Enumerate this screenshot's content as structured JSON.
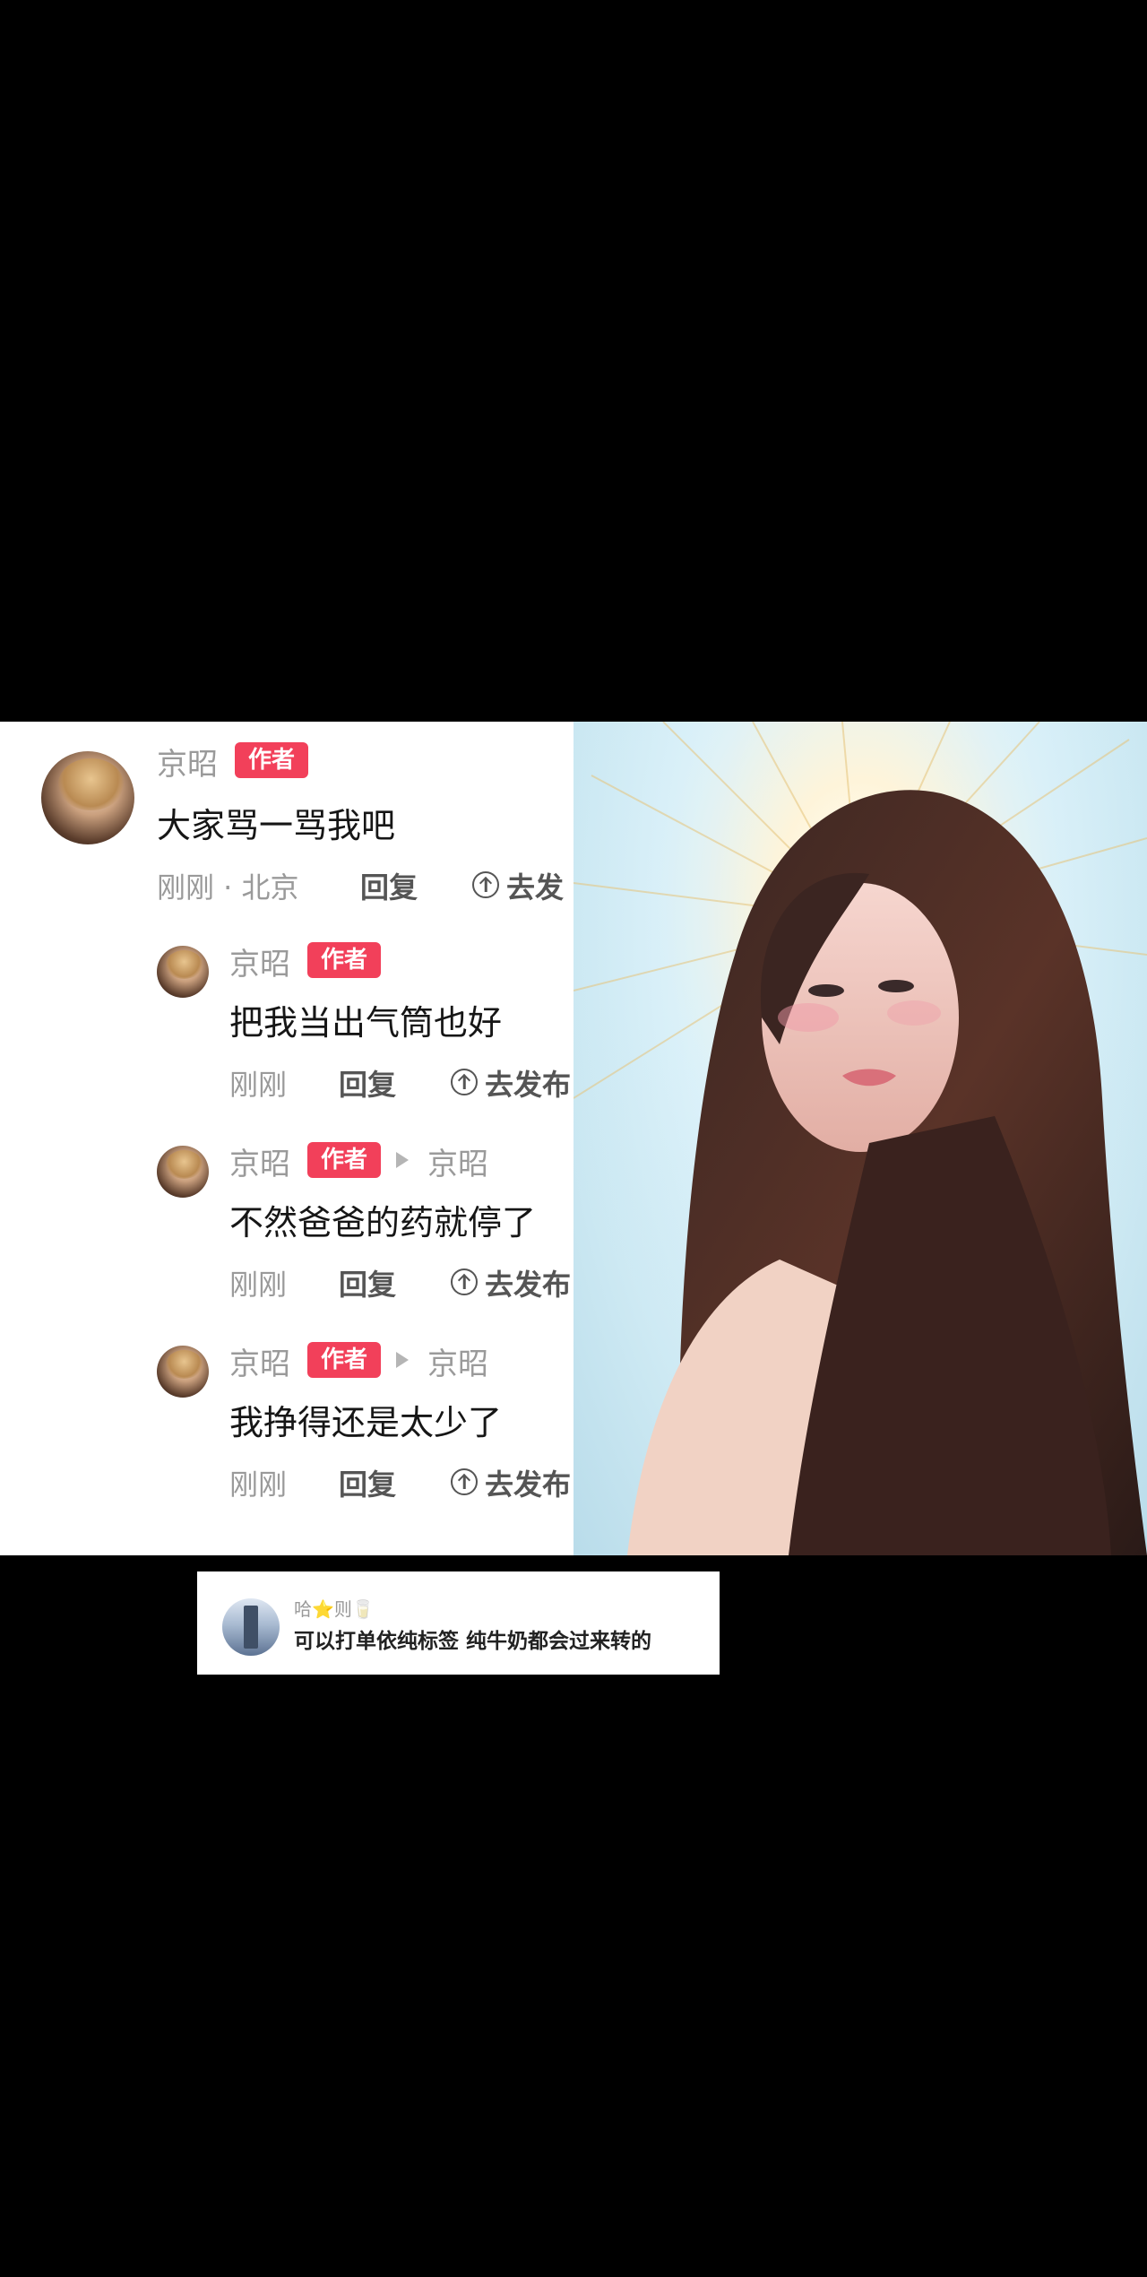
{
  "comments": [
    {
      "name": "京昭",
      "badge": "作者",
      "text": "大家骂一骂我吧",
      "time": "刚刚 · 北京",
      "reply": "回复",
      "publish": "去发"
    },
    {
      "name": "京昭",
      "badge": "作者",
      "text": "把我当出气筒也好",
      "time": "刚刚",
      "reply": "回复",
      "publish": "去发布"
    },
    {
      "name": "京昭",
      "badge": "作者",
      "reply_to": "京昭",
      "text": "不然爸爸的药就停了",
      "time": "刚刚",
      "reply": "回复",
      "publish": "去发布"
    },
    {
      "name": "京昭",
      "badge": "作者",
      "reply_to": "京昭",
      "text": "我挣得还是太少了",
      "time": "刚刚",
      "reply": "回复",
      "publish": "去发布"
    }
  ],
  "caption": {
    "name": "哈⭐则🥛",
    "text": "可以打单依纯标签 纯牛奶都会过来转的"
  },
  "icons": {
    "publish": "arrow-up-circle-icon",
    "reply_arrow": "triangle-right-icon"
  },
  "colors": {
    "badge": "#f2405a",
    "background": "#000000"
  }
}
